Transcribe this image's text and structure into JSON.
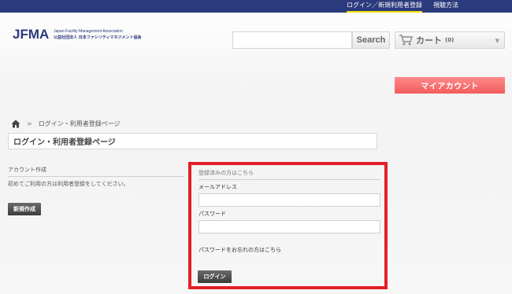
{
  "topbar": {
    "login_link": "ログイン／新規利用者登録",
    "howto_link": "視聴方法"
  },
  "logo": {
    "mark": "JFMA",
    "english": "Japan Facility Management Association",
    "japanese": "公益社団法人 日本ファシリティマネジメント協会"
  },
  "search": {
    "placeholder": "",
    "button_label": "Search"
  },
  "cart": {
    "icon": "cart-icon",
    "label": "カート",
    "count": "(0)"
  },
  "myaccount": {
    "label": "マイアカウント"
  },
  "breadcrumb": {
    "home_icon": "home-icon",
    "separator": ">",
    "current": "ログイン・利用者登録ページ"
  },
  "page_title": "ログイン・利用者登録ページ",
  "new_account": {
    "heading": "アカウント作成",
    "description": "初めてご利用の方は利用者登録をしてください。",
    "button_label": "新規作成"
  },
  "login": {
    "heading": "登録済みの方はこちら",
    "email_label": "メールアドレス",
    "email_value": "",
    "password_label": "パスワード",
    "password_value": "",
    "forgot_link": "パスワードをお忘れの方はこちら",
    "button_label": "ログイン"
  },
  "colors": {
    "topbar": "#2b3a7c",
    "accent_underline": "#f4e000",
    "myaccount": "#f45c5c",
    "highlight_border": "#e32027"
  }
}
